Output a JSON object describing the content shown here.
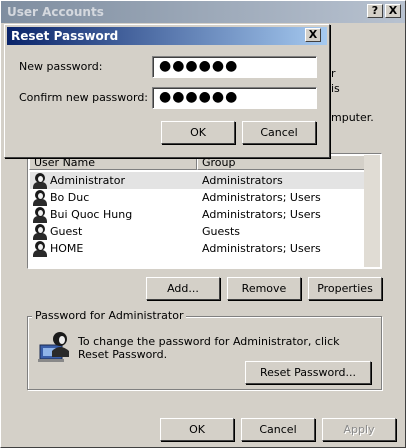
{
  "window": {
    "title": "User Accounts",
    "help_button": "?",
    "close_button": "X"
  },
  "partial_text": {
    "line1": "r",
    "line2": "is",
    "line3": "mputer."
  },
  "users_list": {
    "columns": [
      "User Name",
      "Group"
    ],
    "rows": [
      {
        "name": "Administrator",
        "group": "Administrators"
      },
      {
        "name": "Bo Duc",
        "group": "Administrators; Users"
      },
      {
        "name": "Bui Quoc Hung",
        "group": "Administrators; Users"
      },
      {
        "name": "Guest",
        "group": "Guests"
      },
      {
        "name": "HOME",
        "group": "Administrators; Users"
      }
    ]
  },
  "list_buttons": {
    "add": "Add...",
    "remove": "Remove",
    "properties": "Properties"
  },
  "password_group": {
    "title": "Password for Administrator",
    "description": "To change the password for Administrator, click Reset Password.",
    "reset_button": "Reset Password..."
  },
  "footer": {
    "ok": "OK",
    "cancel": "Cancel",
    "apply": "Apply"
  },
  "dialog": {
    "title": "Reset Password",
    "close_button": "X",
    "new_password_label": "New password:",
    "new_password_value": "●●●●●●",
    "confirm_label": "Confirm new password:",
    "confirm_value": "●●●●●●",
    "ok": "OK",
    "cancel": "Cancel"
  }
}
